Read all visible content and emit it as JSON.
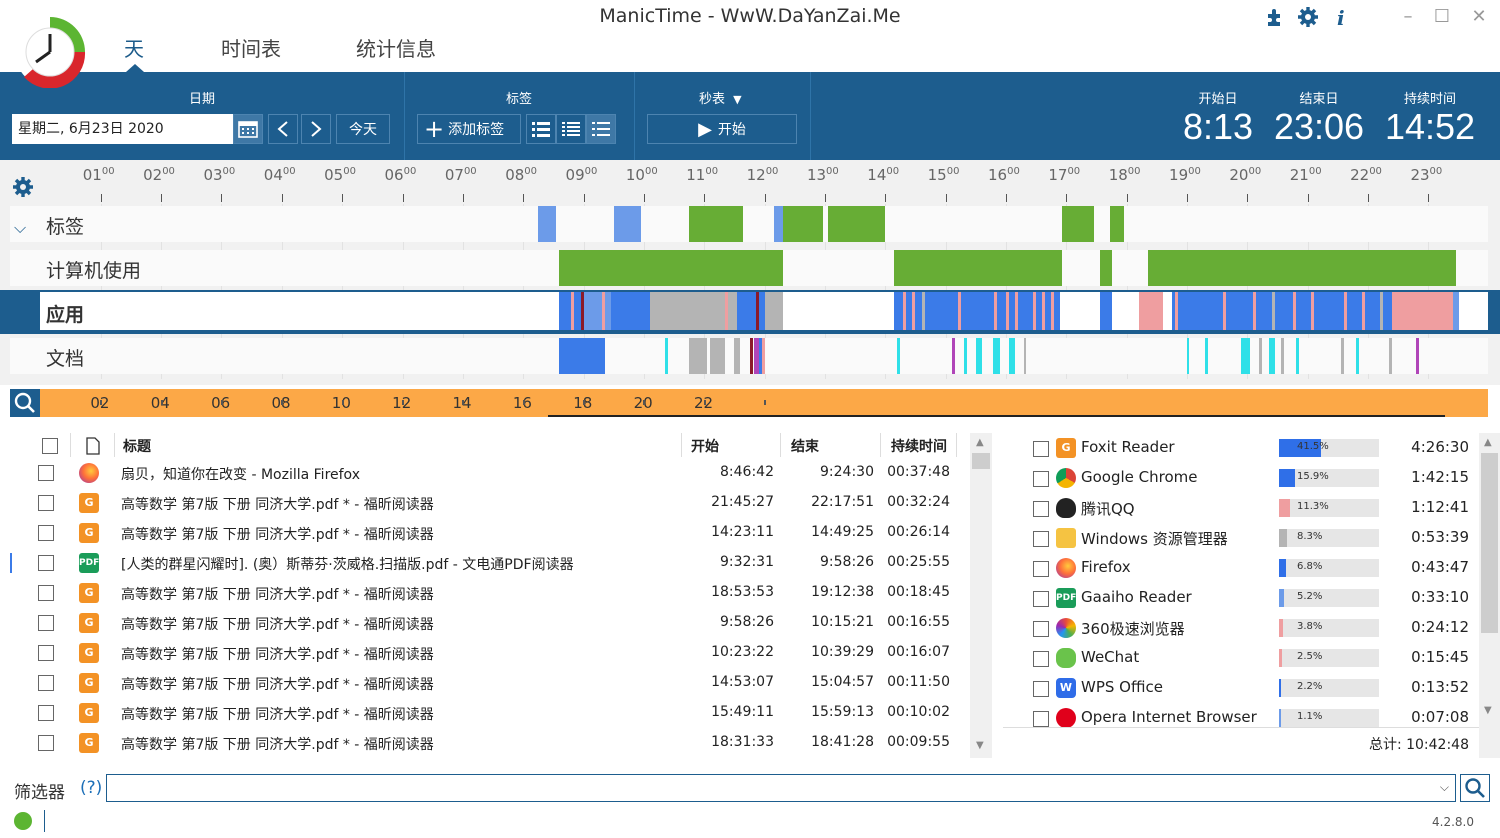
{
  "window": {
    "title": "ManicTime - WwW.DaYanZai.Me"
  },
  "nav": {
    "tabs": [
      "天",
      "时间表",
      "统计信息"
    ]
  },
  "toolbar": {
    "date_label": "日期",
    "date_value": "星期二, 6月23日 2020",
    "today_label": "今天",
    "tags_label": "标签",
    "add_tag_label": "添加标签",
    "stopwatch_label": "秒表",
    "start_label": "开始",
    "start_day_label": "开始日",
    "end_day_label": "结束日",
    "duration_label": "持续时间",
    "start_day": "8:13",
    "end_day": "23:06",
    "duration": "14:52"
  },
  "timeline": {
    "hours": [
      "01",
      "02",
      "03",
      "04",
      "05",
      "06",
      "07",
      "08",
      "09",
      "10",
      "11",
      "12",
      "13",
      "14",
      "15",
      "16",
      "17",
      "18",
      "19",
      "20",
      "21",
      "22",
      "23"
    ],
    "minutes_suffix": "00",
    "rows": {
      "tags": "标签",
      "computer": "计算机使用",
      "apps": "应用",
      "docs": "文档"
    },
    "overview_labels": [
      "02",
      "04",
      "06",
      "08",
      "10",
      "12",
      "14",
      "16",
      "18",
      "20",
      "22"
    ],
    "colors": {
      "green": "#67ad35",
      "blue": "#3b7be8",
      "lightblue": "#6c9be9",
      "pink": "#ef9ea0",
      "gray": "#b4b4b4",
      "cyan": "#2fe0e8",
      "magenta": "#b045b8",
      "darkred": "#8b1a2a"
    }
  },
  "table": {
    "headers": {
      "title": "标题",
      "start": "开始",
      "end": "结束",
      "duration": "持续时间"
    },
    "rows": [
      {
        "icon": "firefox-icon",
        "title": "扇贝，知道你在改变 - Mozilla Firefox",
        "start": "8:46:42",
        "end": "9:24:30",
        "duration": "00:37:48"
      },
      {
        "icon": "foxit-icon",
        "title": "高等数学 第7版 下册 同济大学.pdf * - 福昕阅读器",
        "start": "21:45:27",
        "end": "22:17:51",
        "duration": "00:32:24"
      },
      {
        "icon": "foxit-icon",
        "title": "高等数学 第7版 下册 同济大学.pdf * - 福昕阅读器",
        "start": "14:23:11",
        "end": "14:49:25",
        "duration": "00:26:14"
      },
      {
        "icon": "pdf-icon",
        "title": "[人类的群星闪耀时]. (奥）斯蒂芬·茨威格.扫描版.pdf - 文电通PDF阅读器",
        "start": "9:32:31",
        "end": "9:58:26",
        "duration": "00:25:55"
      },
      {
        "icon": "foxit-icon",
        "title": "高等数学 第7版 下册 同济大学.pdf * - 福昕阅读器",
        "start": "18:53:53",
        "end": "19:12:38",
        "duration": "00:18:45"
      },
      {
        "icon": "foxit-icon",
        "title": "高等数学 第7版 下册 同济大学.pdf * - 福昕阅读器",
        "start": "9:58:26",
        "end": "10:15:21",
        "duration": "00:16:55"
      },
      {
        "icon": "foxit-icon",
        "title": "高等数学 第7版 下册 同济大学.pdf * - 福昕阅读器",
        "start": "10:23:22",
        "end": "10:39:29",
        "duration": "00:16:07"
      },
      {
        "icon": "foxit-icon",
        "title": "高等数学 第7版 下册 同济大学.pdf * - 福昕阅读器",
        "start": "14:53:07",
        "end": "15:04:57",
        "duration": "00:11:50"
      },
      {
        "icon": "foxit-icon",
        "title": "高等数学 第7版 下册 同济大学.pdf * - 福昕阅读器",
        "start": "15:49:11",
        "end": "15:59:13",
        "duration": "00:10:02"
      },
      {
        "icon": "foxit-icon",
        "title": "高等数学 第7版 下册 同济大学.pdf * - 福昕阅读器",
        "start": "18:31:33",
        "end": "18:41:28",
        "duration": "00:09:55"
      }
    ]
  },
  "stats": {
    "rows": [
      {
        "name": "Foxit Reader",
        "pct": "41.5%",
        "frac": 0.415,
        "time": "4:26:30",
        "color": "#2f6fe8"
      },
      {
        "name": "Google Chrome",
        "pct": "15.9%",
        "frac": 0.159,
        "time": "1:42:15",
        "color": "#2f6fe8"
      },
      {
        "name": "腾讯QQ",
        "pct": "11.3%",
        "frac": 0.113,
        "time": "1:12:41",
        "color": "#ef9ea0"
      },
      {
        "name": "Windows 资源管理器",
        "pct": "8.3%",
        "frac": 0.083,
        "time": "0:53:39",
        "color": "#b4b4b4"
      },
      {
        "name": "Firefox",
        "pct": "6.8%",
        "frac": 0.068,
        "time": "0:43:47",
        "color": "#2f6fe8"
      },
      {
        "name": "Gaaiho Reader",
        "pct": "5.2%",
        "frac": 0.052,
        "time": "0:33:10",
        "color": "#6c9be9"
      },
      {
        "name": "360极速浏览器",
        "pct": "3.8%",
        "frac": 0.038,
        "time": "0:24:12",
        "color": "#ef9ea0"
      },
      {
        "name": "WeChat",
        "pct": "2.5%",
        "frac": 0.025,
        "time": "0:15:45",
        "color": "#ef9ea0"
      },
      {
        "name": "WPS Office",
        "pct": "2.2%",
        "frac": 0.022,
        "time": "0:13:52",
        "color": "#2f6fe8"
      },
      {
        "name": "Opera Internet Browser",
        "pct": "1.1%",
        "frac": 0.011,
        "time": "0:07:08",
        "color": "#6c9be9"
      }
    ],
    "total": "总计: 10:42:48"
  },
  "filter": {
    "label": "筛选器",
    "help": "(?)"
  },
  "status": {
    "version": "4.2.8.0"
  }
}
